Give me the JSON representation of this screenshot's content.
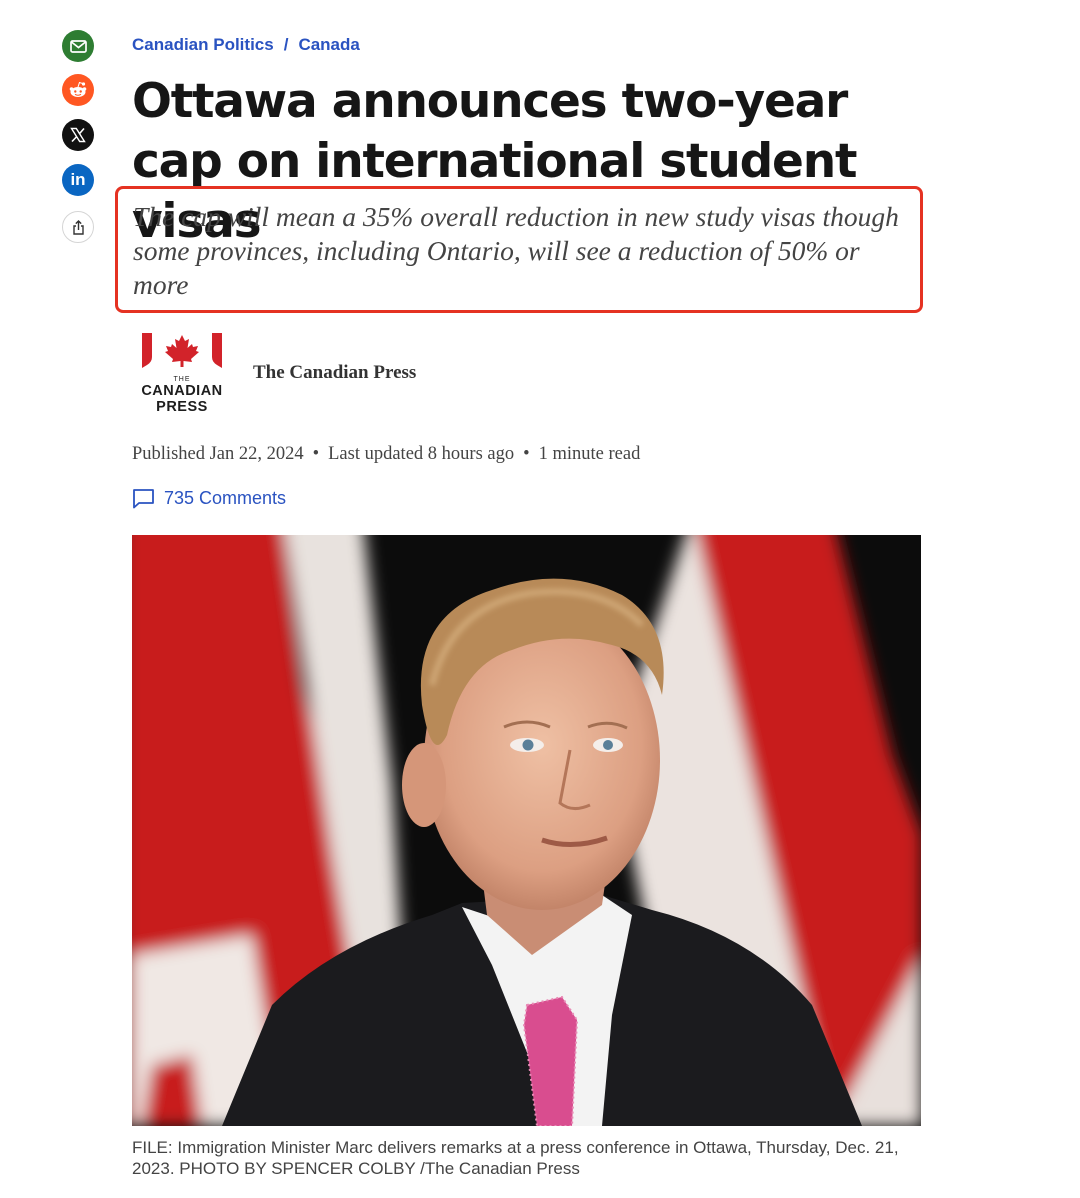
{
  "share": {
    "email": "email-icon",
    "reddit": "reddit-icon",
    "x": "x-icon",
    "linkedin": "in",
    "share": "share-icon"
  },
  "breadcrumb": {
    "section": "Canadian Politics",
    "separator": "/",
    "subsection": "Canada"
  },
  "article": {
    "headline": "Ottawa announces two-year cap on international student visas",
    "deck": "The cap will mean a 35% overall reduction in new study visas though some provinces, including Ontario, will see a reduction of 50% or more"
  },
  "author": {
    "logo_the": "THE",
    "logo_line1": "CANADIAN",
    "logo_line2": "PRESS",
    "name": "The Canadian Press"
  },
  "meta": {
    "published": "Published Jan 22, 2024",
    "updated": "Last updated 8 hours ago",
    "read_time": "1 minute read",
    "separator": "•",
    "comments": "735 Comments"
  },
  "photo": {
    "caption": "FILE: Immigration Minister Marc delivers remarks at a press conference in Ottawa, Thursday, Dec. 21, 2023. PHOTO BY SPENCER COLBY /The Canadian Press"
  },
  "colors": {
    "link": "#2a53c1",
    "highlight_border": "#e53222",
    "flag_red": "#d2232a"
  }
}
